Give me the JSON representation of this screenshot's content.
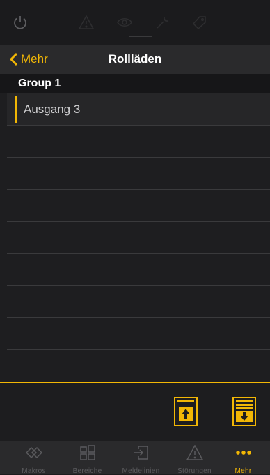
{
  "nav": {
    "back_label": "Mehr",
    "title": "Rollläden"
  },
  "group": {
    "title": "Group 1"
  },
  "list": {
    "items": [
      "Ausgang 3"
    ]
  },
  "actions": {
    "up_icon": "shutter-up-icon",
    "down_icon": "shutter-down-icon"
  },
  "tabs": [
    {
      "label": "Makros",
      "icon": "macros-icon",
      "active": false
    },
    {
      "label": "Bereiche",
      "icon": "areas-icon",
      "active": false
    },
    {
      "label": "Meldelinien",
      "icon": "detector-lines-icon",
      "active": false
    },
    {
      "label": "Störungen",
      "icon": "warning-icon",
      "active": false
    },
    {
      "label": "Mehr",
      "icon": "more-icon",
      "active": true
    }
  ],
  "colors": {
    "accent": "#f2b705",
    "background": "#1c1c1e"
  }
}
